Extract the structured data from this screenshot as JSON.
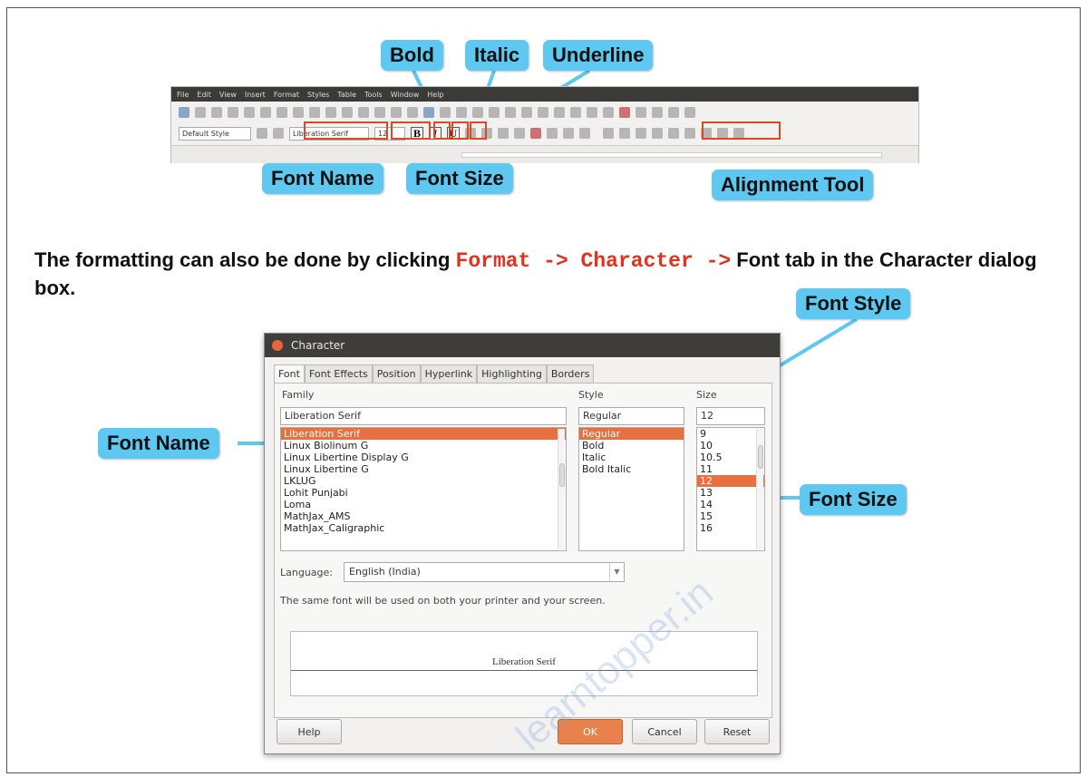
{
  "callouts": {
    "bold": "Bold",
    "italic": "Italic",
    "underline": "Underline",
    "font_name_top": "Font Name",
    "font_size_top": "Font Size",
    "alignment": "Alignment Tool",
    "font_style": "Font Style",
    "font_name_left": "Font Name",
    "font_size_right": "Font Size"
  },
  "toolbar": {
    "menu": [
      "File",
      "Edit",
      "View",
      "Insert",
      "Format",
      "Styles",
      "Table",
      "Tools",
      "Window",
      "Help"
    ],
    "paragraph_style": "Default Style",
    "font_name": "Liberation Serif",
    "font_size": "12",
    "bold_glyph": "B",
    "italic_glyph": "I",
    "underline_glyph": "U"
  },
  "description": {
    "part1": "The formatting can also be done by clicking ",
    "code": "Format -> Character ->",
    "part2": " Font tab in the Character dialog box."
  },
  "dialog": {
    "title": "Character",
    "tabs": [
      "Font",
      "Font Effects",
      "Position",
      "Hyperlink",
      "Highlighting",
      "Borders"
    ],
    "family_label": "Family",
    "style_label": "Style",
    "size_label": "Size",
    "family_value": "Liberation Serif",
    "style_value": "Regular",
    "size_value": "12",
    "families": [
      "Liberation Serif",
      "Linux Biolinum G",
      "Linux Libertine Display G",
      "Linux Libertine G",
      "LKLUG",
      "Lohit Punjabi",
      "Loma",
      "MathJax_AMS",
      "MathJax_Caligraphic"
    ],
    "styles": [
      "Regular",
      "Bold",
      "Italic",
      "Bold Italic"
    ],
    "sizes": [
      "9",
      "10",
      "10.5",
      "11",
      "12",
      "13",
      "14",
      "15",
      "16"
    ],
    "language_label": "Language:",
    "language_value": "English (India)",
    "info_text": "The same font will be used on both your printer and your screen.",
    "preview_text": "Liberation Serif",
    "buttons": {
      "help": "Help",
      "ok": "OK",
      "cancel": "Cancel",
      "reset": "Reset"
    }
  },
  "watermark": "learntopper.in",
  "colors": {
    "callout": "#5ec8f0",
    "highlight_box": "#d94a2a",
    "code_text": "#e0321e",
    "list_selection": "#e86f3f"
  }
}
